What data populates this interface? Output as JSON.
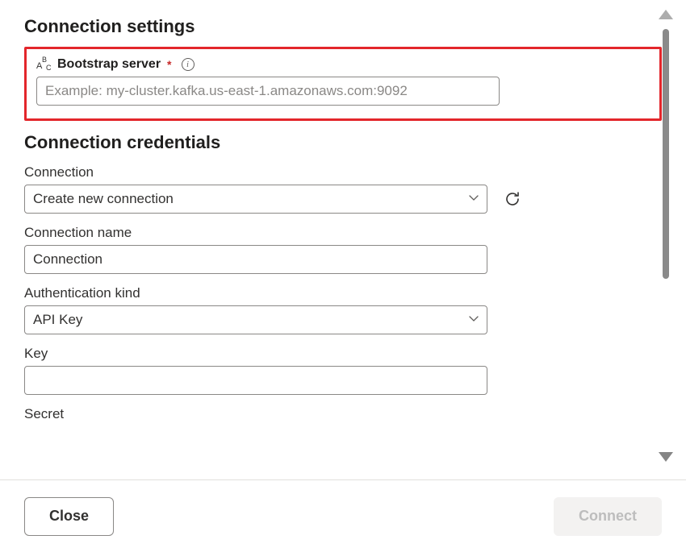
{
  "sections": {
    "connection_settings_title": "Connection settings",
    "connection_credentials_title": "Connection credentials"
  },
  "bootstrap_server": {
    "label": "Bootstrap server",
    "placeholder": "Example: my-cluster.kafka.us-east-1.amazonaws.com:9092",
    "value": ""
  },
  "connection": {
    "label": "Connection",
    "value": "Create new connection"
  },
  "connection_name": {
    "label": "Connection name",
    "value": "Connection"
  },
  "authentication_kind": {
    "label": "Authentication kind",
    "value": "API Key"
  },
  "key": {
    "label": "Key",
    "value": ""
  },
  "secret": {
    "label": "Secret",
    "value": ""
  },
  "footer": {
    "close": "Close",
    "connect": "Connect"
  }
}
